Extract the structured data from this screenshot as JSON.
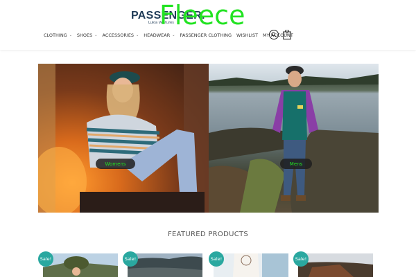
{
  "brand": {
    "name": "PASSENGER.",
    "tagline": "Lukla Ventures"
  },
  "nav": {
    "items": [
      {
        "label": "CLOTHING",
        "has_dropdown": true
      },
      {
        "label": "SHOES",
        "has_dropdown": true
      },
      {
        "label": "ACCESSORIES",
        "has_dropdown": true
      },
      {
        "label": "HEADWEAR",
        "has_dropdown": true
      },
      {
        "label": "PASSENGER CLOTHING",
        "has_dropdown": false
      },
      {
        "label": "WISHLIST",
        "has_dropdown": false
      },
      {
        "label": "MY ACCOUNT",
        "has_dropdown": false
      }
    ],
    "cart_count": "0"
  },
  "hero": {
    "title": "Fleece",
    "buttons": [
      {
        "label": "Womens"
      },
      {
        "label": "Mens"
      }
    ],
    "title_color": "#22e322"
  },
  "featured": {
    "heading": "FEATURED PRODUCTS",
    "badge": "Sale!",
    "badge_color": "#2aa8a0"
  }
}
